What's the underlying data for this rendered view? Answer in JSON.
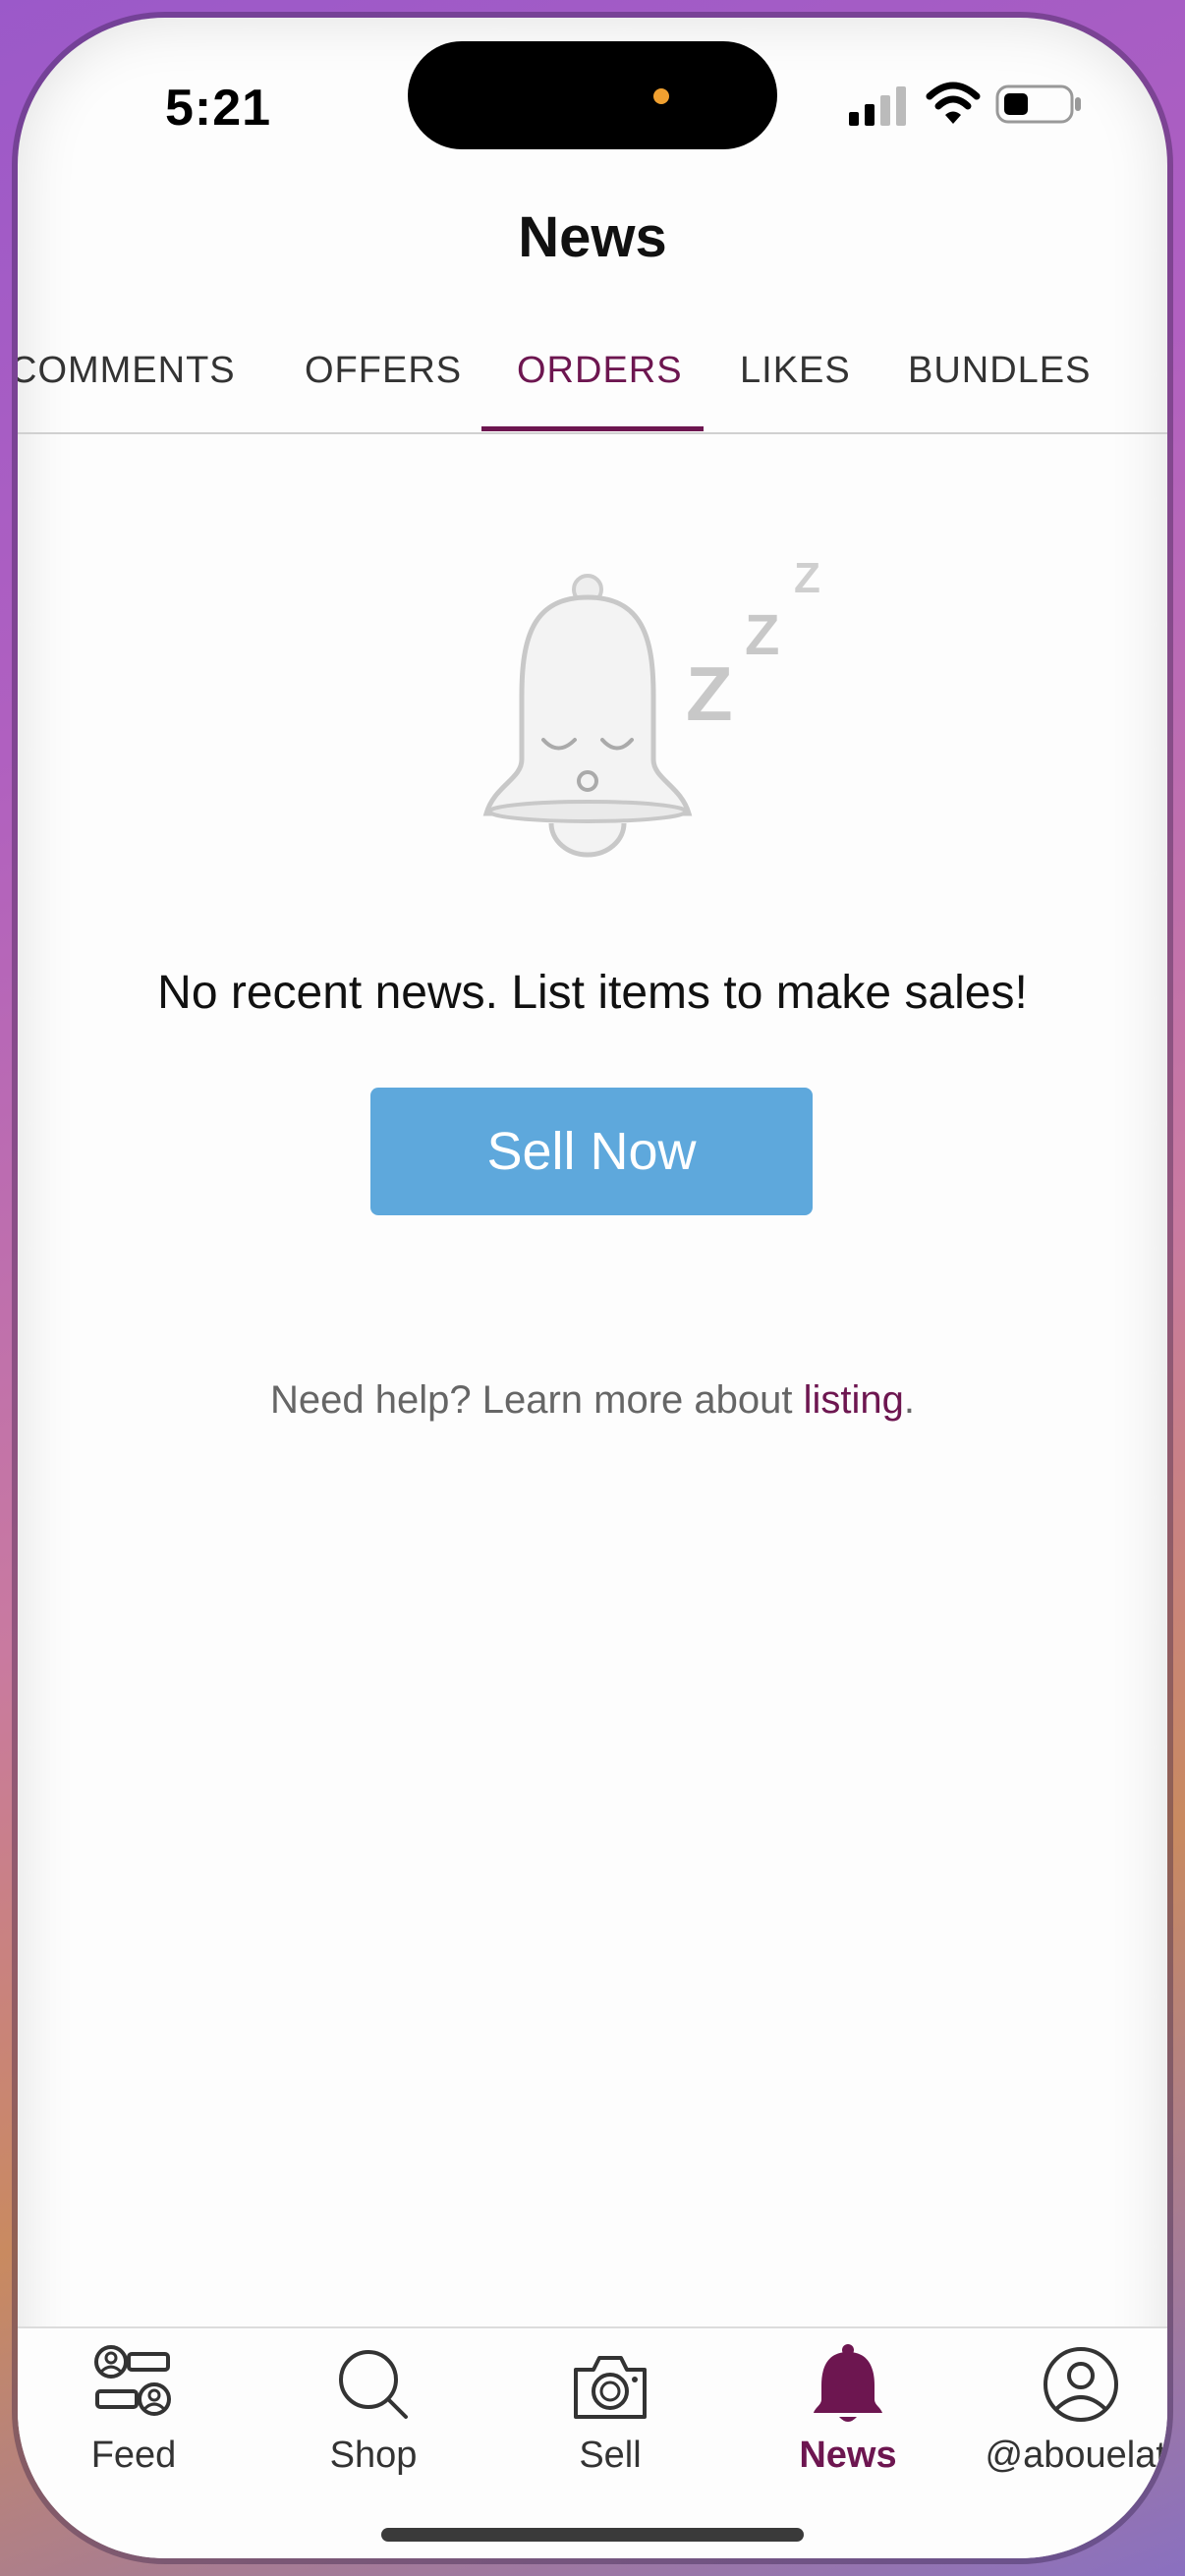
{
  "status_bar": {
    "time": "5:21"
  },
  "header": {
    "title": "News"
  },
  "tabs": [
    {
      "label": "COMMENTS",
      "active": false
    },
    {
      "label": "OFFERS",
      "active": false
    },
    {
      "label": "ORDERS",
      "active": true
    },
    {
      "label": "LIKES",
      "active": false
    },
    {
      "label": "BUNDLES",
      "active": false
    }
  ],
  "empty_state": {
    "message": "No recent news. List items to make sales!",
    "button_label": "Sell Now",
    "help_prefix": "Need help? Learn more about ",
    "help_link": "listing",
    "help_suffix": ".",
    "illustration_icon": "sleeping-bell-icon"
  },
  "bottom_nav": [
    {
      "label": "Feed",
      "icon": "feed-icon"
    },
    {
      "label": "Shop",
      "icon": "search-icon"
    },
    {
      "label": "Sell",
      "icon": "camera-icon"
    },
    {
      "label": "News",
      "icon": "bell-icon",
      "active": true
    },
    {
      "label": "@abouelatt",
      "icon": "profile-icon"
    }
  ],
  "colors": {
    "accent": "#6d1650",
    "button": "#5ea8dc"
  }
}
